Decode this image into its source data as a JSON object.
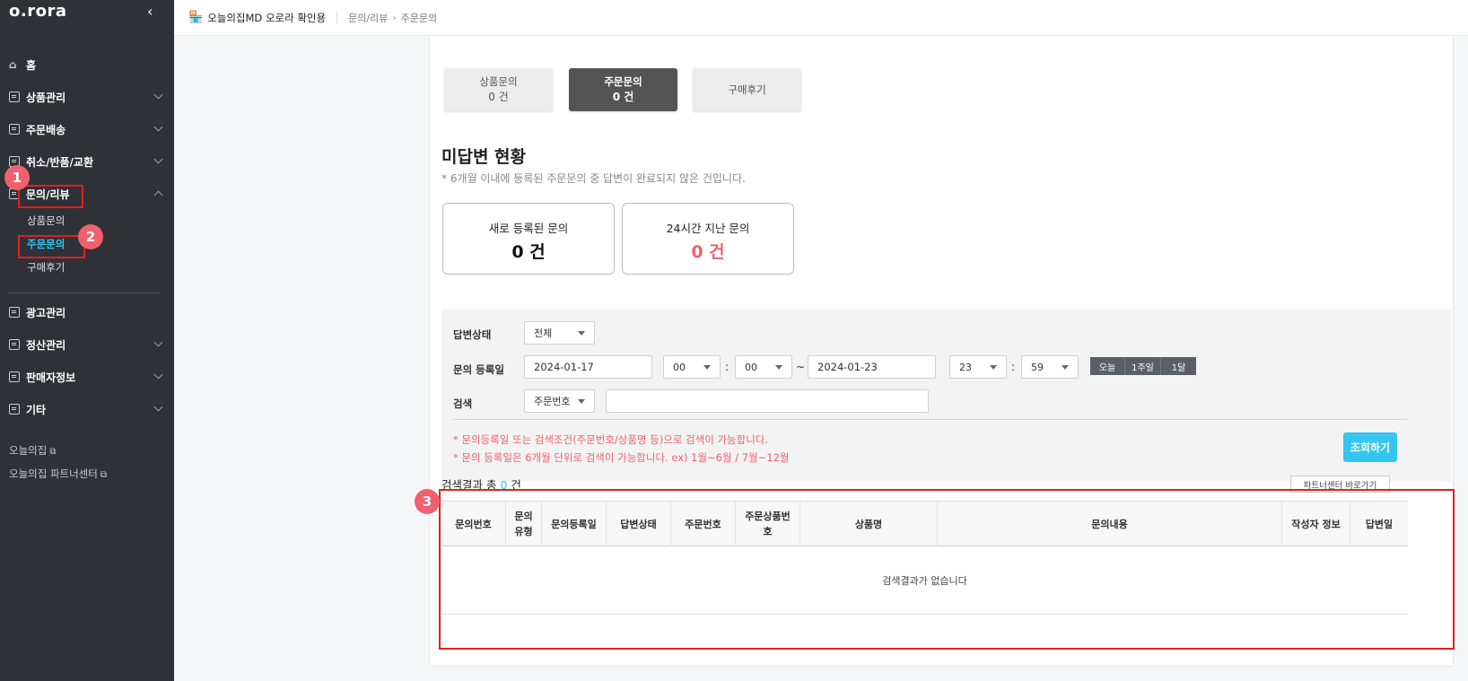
{
  "sidebar": {
    "logo": "o.rora",
    "collapse": "‹",
    "home": "홈",
    "items": [
      {
        "label": "상품관리"
      },
      {
        "label": "주문배송"
      },
      {
        "label": "취소/반품/교환"
      },
      {
        "label": "문의/리뷰"
      },
      {
        "label": "광고관리"
      },
      {
        "label": "정산관리"
      },
      {
        "label": "판매자정보"
      },
      {
        "label": "기타"
      }
    ],
    "sub_items": [
      {
        "label": "상품문의"
      },
      {
        "label": "주문문의"
      },
      {
        "label": "구매후기"
      }
    ],
    "links": [
      {
        "label": "오늘의집"
      },
      {
        "label": "오늘의집 파트너센터"
      }
    ],
    "badges": [
      "1",
      "2",
      "3"
    ],
    "accent_color": "#35c5f0",
    "badge_color": "#f0616d"
  },
  "header": {
    "store_name": "오늘의집MD 오로라 확인용",
    "breadcrumb": [
      "문의/리뷰",
      "주문문의"
    ]
  },
  "tabs": [
    {
      "label": "상품문의",
      "count": "0 건"
    },
    {
      "label": "주문문의",
      "count": "0 건"
    },
    {
      "label": "구매후기",
      "count": ""
    }
  ],
  "status": {
    "title": "미답변 현황",
    "description": "* 6개월 이내에 등록된 주문문의 중 답변이 완료되지 않은 건입니다.",
    "cards": [
      {
        "label": "새로 등록된 문의",
        "value": "0 건"
      },
      {
        "label": "24시간 지난 문의",
        "value": "0 건"
      }
    ]
  },
  "filter": {
    "answer_status_label": "답변상태",
    "answer_status_value": "전체",
    "date_label": "문의 등록일",
    "start_date": "2024-01-17",
    "start_hour": "00",
    "start_min": "00",
    "tilde": "~",
    "end_date": "2024-01-23",
    "end_hour": "23",
    "end_min": "59",
    "quick": [
      "오늘",
      "1주일",
      "1달"
    ],
    "search_label": "검색",
    "search_type": "주문번호",
    "search_value": "",
    "notes": [
      "* 문의등록일 또는 검색조건(주문번호/상품명 등)으로 검색이 가능합니다.",
      "* 문의 등록일은 6개월 단위로 검색이 가능합니다. ex) 1월~6월 / 7월~12월"
    ],
    "search_button": "조회하기"
  },
  "results": {
    "prefix": "검색결과 총",
    "count": "0",
    "suffix": "건",
    "partner_button": "파트너센터 바로가기",
    "columns": [
      "문의번호",
      "문의\n유형",
      "문의등록일",
      "답변상태",
      "주문번호",
      "주문상품번\n호",
      "상품명",
      "문의내용",
      "작성자 정보",
      "답변일"
    ],
    "empty_text": "검색결과가 없습니다"
  }
}
